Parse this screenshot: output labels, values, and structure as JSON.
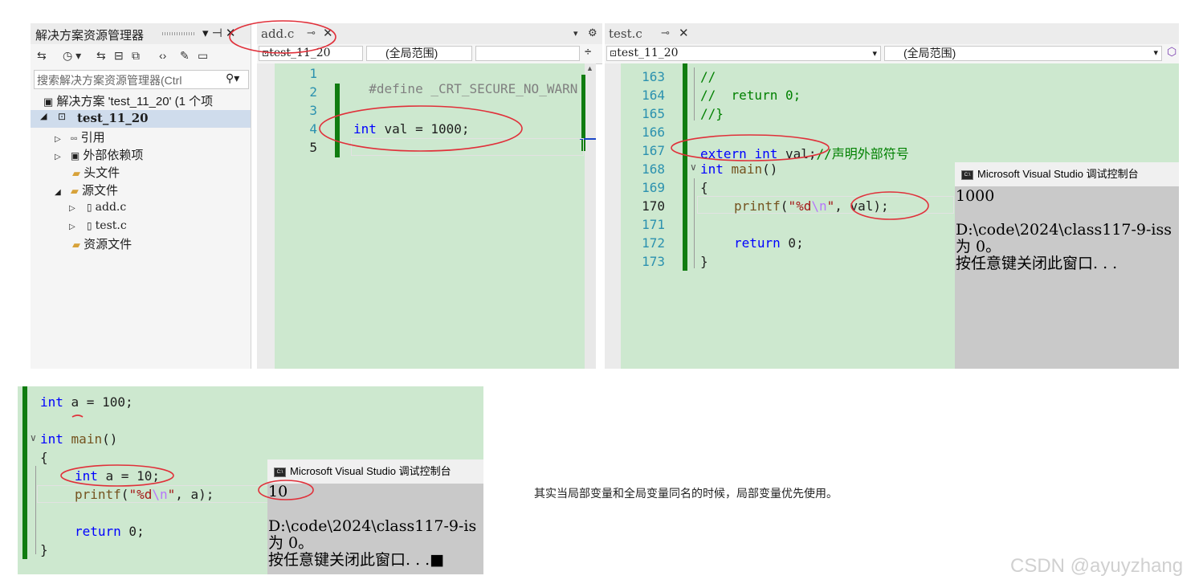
{
  "solution_explorer": {
    "title": "解决方案资源管理器",
    "pin_glyph": "▾ ⊣ ✕",
    "toolbar_glyphs": [
      "⇆",
      "◷ ▾",
      "⇆",
      "⊟",
      "⧉",
      "‹›",
      "✎",
      "▭"
    ],
    "search_placeholder": "搜索解决方案资源管理器(Ctrl",
    "tree": [
      {
        "label": "解决方案 'test_11_20' (1 个项",
        "level": 0
      },
      {
        "label": "test_11_20",
        "level": 1,
        "selected": true
      },
      {
        "label": "引用",
        "level": 2
      },
      {
        "label": "外部依赖项",
        "level": 2
      },
      {
        "label": "头文件",
        "level": 2
      },
      {
        "label": "源文件",
        "level": 2
      },
      {
        "label": "add.c",
        "level": 3
      },
      {
        "label": "test.c",
        "level": 3
      },
      {
        "label": "资源文件",
        "level": 2
      }
    ]
  },
  "add_editor": {
    "tab": "add.c",
    "project_dropdown": "test_11_20",
    "scope_dropdown": "(全局范围)",
    "line_numbers": [
      "1",
      "2",
      "3",
      "4",
      "5"
    ],
    "line1": "#define _CRT_SECURE_NO_WARN",
    "line4_kw": "int",
    "line4_rest": " val = 1000;"
  },
  "test_editor": {
    "tab": "test.c",
    "project_dropdown": "test_11_20",
    "scope_dropdown": "(全局范围)",
    "line_numbers": [
      "163",
      "164",
      "165",
      "166",
      "167",
      "168",
      "169",
      "170",
      "171",
      "172",
      "173"
    ],
    "l163": "//",
    "l164": "//  return 0;",
    "l165": "//}",
    "l167_kw1": "extern",
    "l167_kw2": "int",
    "l167_id": " val;",
    "l167_cm": "//声明外部符号",
    "l168_kw": "int",
    "l168_fn": "main",
    "l168_rest": "()",
    "l169": "{",
    "l170_fn": "printf",
    "l170_str1": "\"%d",
    "l170_esc": "\\n",
    "l170_str2": "\"",
    "l170_rest": ", val);",
    "l172_kw": "return",
    "l172_rest": " 0;",
    "l173": "}"
  },
  "console_top": {
    "title": "Microsoft Visual Studio 调试控制台",
    "lines": [
      "1000",
      "",
      "D:\\code\\2024\\class117-9-iss",
      "为 0。",
      "按任意键关闭此窗口. . ."
    ]
  },
  "snippet": {
    "l1_kw": "int",
    "l1_rest": " a = 100;",
    "l3_kw": "int",
    "l3_fn": "main",
    "l3_rest": "()",
    "l4": "{",
    "l5_kw": "int",
    "l5_rest": " a = 10;",
    "l6_fn": "printf",
    "l6_str1": "\"%d",
    "l6_esc": "\\n",
    "l6_str2": "\"",
    "l6_rest": ", a);",
    "l8_kw": "return",
    "l8_rest": " 0;",
    "l9": "}"
  },
  "console_bottom": {
    "title": "Microsoft Visual Studio 调试控制台",
    "lines": [
      "10",
      "",
      "D:\\code\\2024\\class117-9-is",
      "为 0。",
      "按任意键关闭此窗口. . .■"
    ]
  },
  "note": "其实当局部变量和全局变量同名的时候，局部变量优先使用。",
  "watermark": "CSDN @ayuyzhang"
}
